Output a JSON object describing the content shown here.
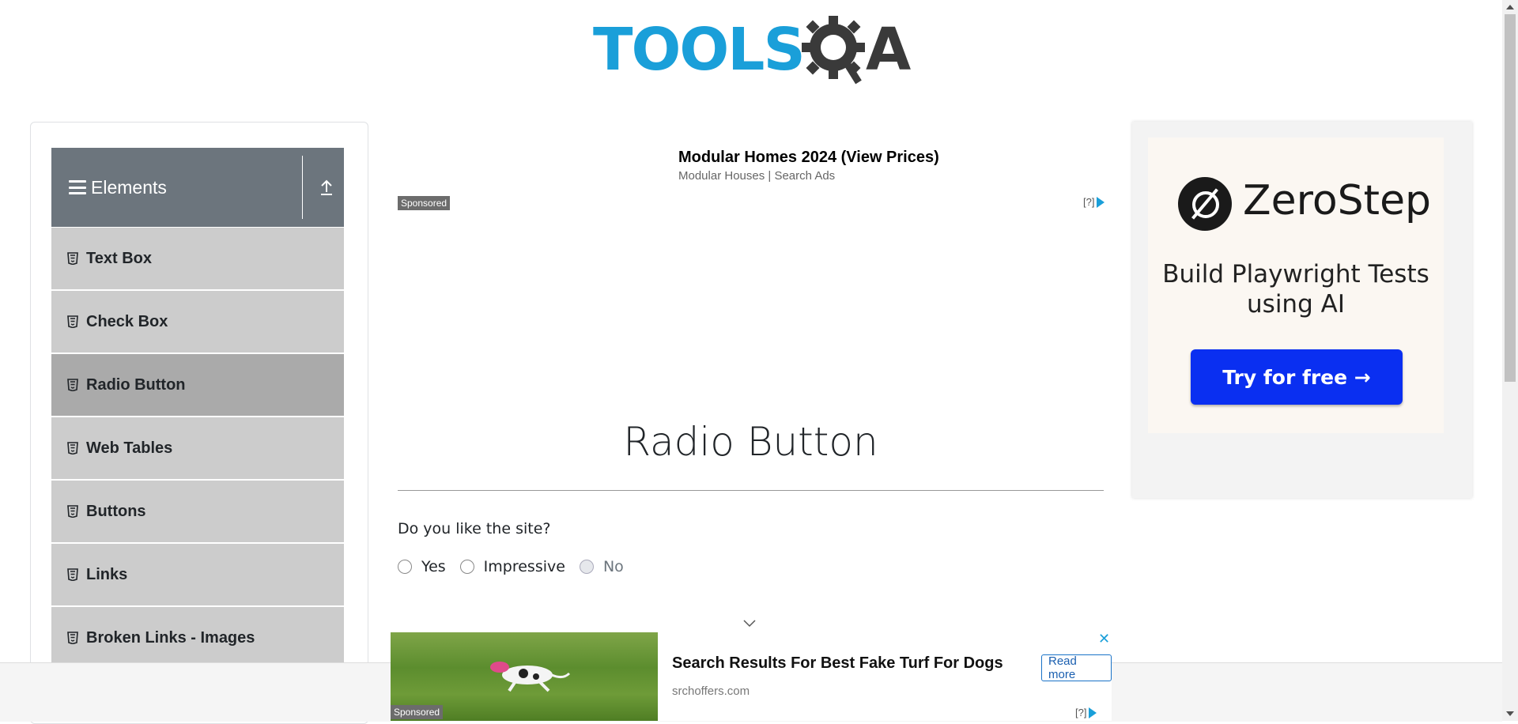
{
  "header": {
    "logo_text": "TOOLS",
    "logo_text_suffix": "A",
    "logo_alt": "TOOLSQA"
  },
  "sidebar": {
    "group_title": "Elements",
    "items": [
      {
        "label": "Text Box"
      },
      {
        "label": "Check Box"
      },
      {
        "label": "Radio Button",
        "active": true
      },
      {
        "label": "Web Tables"
      },
      {
        "label": "Buttons"
      },
      {
        "label": "Links"
      },
      {
        "label": "Broken Links - Images"
      }
    ]
  },
  "ad_top": {
    "title": "Modular Homes 2024 (View Prices)",
    "subtitle": "Modular Houses | Search Ads",
    "sponsored": "Sponsored",
    "adchoice": "[?]"
  },
  "main": {
    "title": "Radio Button",
    "question": "Do you like the site?",
    "options": [
      {
        "label": "Yes",
        "disabled": false
      },
      {
        "label": "Impressive",
        "disabled": false
      },
      {
        "label": "No",
        "disabled": true
      }
    ]
  },
  "right_ad": {
    "brand": "ZeroStep",
    "tagline": "Build Playwright Tests using AI",
    "cta": "Try for free →"
  },
  "bottom_ad": {
    "title": "Search Results For Best Fake Turf For Dogs",
    "subtitle": "srchoffers.com",
    "read_more": "Read more",
    "close": "✕",
    "sponsored": "Sponsored",
    "adchoice": "[?]"
  }
}
